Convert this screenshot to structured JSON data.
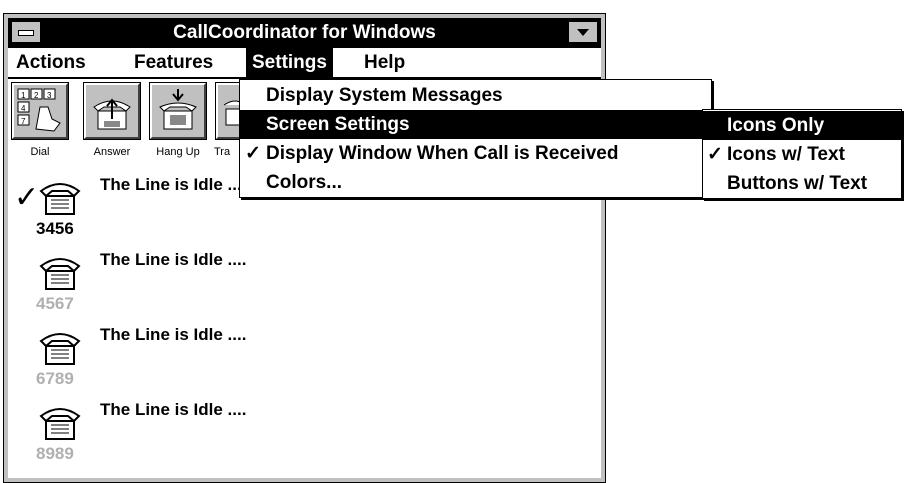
{
  "window": {
    "title": "CallCoordinator for Windows"
  },
  "menubar": {
    "actions": "Actions",
    "features": "Features",
    "settings": "Settings",
    "help": "Help"
  },
  "toolbar": {
    "dial": "Dial",
    "answer": "Answer",
    "hangup": "Hang Up",
    "transfer": "Tra"
  },
  "settings_menu": {
    "item1": "Display System Messages",
    "item2": "Screen Settings",
    "item3": "Display Window When Call is Received",
    "item3_check": "✓",
    "item4": "Colors..."
  },
  "screen_submenu": {
    "item1": "Icons Only",
    "item2": "Icons w/ Text",
    "item2_check": "✓",
    "item3": "Buttons w/ Text"
  },
  "lines": [
    {
      "status": "The Line is Idle ....",
      "number": "3456",
      "active": true,
      "check": "✓"
    },
    {
      "status": "The Line is Idle ....",
      "number": "4567",
      "active": false
    },
    {
      "status": "The Line is Idle ....",
      "number": "6789",
      "active": false
    },
    {
      "status": "The Line is Idle ....",
      "number": "8989",
      "active": false
    }
  ],
  "colors": {
    "inactive_number": "#b0b0b0",
    "active_number": "#000000"
  }
}
